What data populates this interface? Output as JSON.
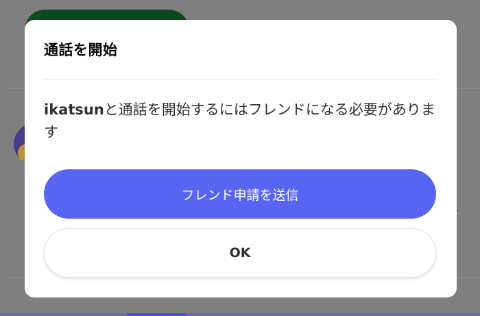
{
  "dialog": {
    "title": "通話を開始",
    "message_user": "ikatsun",
    "message_rest": "と通話を開始するにはフレンドになる必要があります",
    "primary_button": "フレンド申請を送信",
    "secondary_button": "OK"
  },
  "colors": {
    "overlay": "#7f7f7f",
    "primary_button": "#5865f2",
    "dialog_background": "#ffffff"
  }
}
